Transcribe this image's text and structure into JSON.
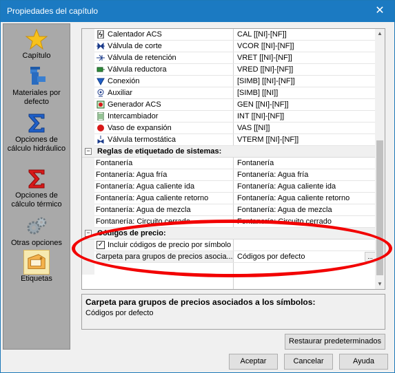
{
  "window": {
    "title": "Propiedades del capítulo",
    "close_glyph": "✕"
  },
  "sidebar": {
    "items": [
      {
        "label": "Capítulo",
        "icon": "star-icon"
      },
      {
        "label": "Materiales por defecto",
        "icon": "pipe-fitting-icon"
      },
      {
        "label": "Opciones de cálculo hidráulico",
        "icon": "blue-sigma-icon"
      },
      {
        "label": "Opciones de cálculo térmico",
        "icon": "red-sigma-icon"
      },
      {
        "label": "Otras opciones",
        "icon": "gears-icon"
      },
      {
        "label": "Etiquetas",
        "icon": "tag-icon",
        "selected": true
      }
    ]
  },
  "grid": {
    "component_rows": [
      {
        "name": "Calentador ACS",
        "value": "CAL [[NI]-[NF]]",
        "icon": "heater-icon"
      },
      {
        "name": "Válvula de corte",
        "value": "VCOR [[NI]-[NF]]",
        "icon": "valve-icon"
      },
      {
        "name": "Válvula de retención",
        "value": "VRET [[NI]-[NF]]",
        "icon": "check-valve-icon"
      },
      {
        "name": "Válvula reductora",
        "value": "VRED [[NI]-[NF]]",
        "icon": "reducing-valve-icon"
      },
      {
        "name": "Conexión",
        "value": "[SIMB] [[NI]-[NF]]",
        "icon": "connection-icon"
      },
      {
        "name": "Auxiliar",
        "value": "[SIMB] [[NI]]",
        "icon": "auxiliary-icon"
      },
      {
        "name": "Generador ACS",
        "value": "GEN [[NI]-[NF]]",
        "icon": "generator-icon"
      },
      {
        "name": "Intercambiador",
        "value": "INT [[NI]-[NF]]",
        "icon": "exchanger-icon"
      },
      {
        "name": "Vaso de expansión",
        "value": "VAS [[NI]]",
        "icon": "expansion-vessel-icon"
      },
      {
        "name": "Válvula termostática",
        "value": "VTERM [[NI]-[NF]]",
        "icon": "thermostatic-valve-icon"
      }
    ],
    "category_systems": {
      "label": "Reglas de etiquetado de sistemas:",
      "toggle": "−"
    },
    "system_rows": [
      {
        "name": "Fontanería",
        "value": "Fontanería"
      },
      {
        "name": "Fontanería: Agua fría",
        "value": "Fontanería: Agua fría"
      },
      {
        "name": "Fontanería: Agua caliente ida",
        "value": "Fontanería: Agua caliente ida"
      },
      {
        "name": "Fontanería: Agua caliente retorno",
        "value": "Fontanería: Agua caliente retorno"
      },
      {
        "name": "Fontanería: Agua de mezcla",
        "value": "Fontanería: Agua de mezcla"
      },
      {
        "name": "Fontanería: Circuito cerrado",
        "value": "Fontanería: Circuito cerrado"
      }
    ],
    "category_prices": {
      "label": "Códigos de precio:",
      "toggle": "−"
    },
    "price_rows": [
      {
        "name": "Incluir códigos de precio por símbolo",
        "value": "",
        "checked": true,
        "check_glyph": "✓"
      },
      {
        "name": "Carpeta para grupos de precios asocia...",
        "value": "Códigos por defecto",
        "ellipsis": "..."
      }
    ]
  },
  "description": {
    "title": "Carpeta para grupos de precios asociados a los símbolos:",
    "text": "Códigos por defecto"
  },
  "buttons": {
    "restore": "Restaurar predeterminados",
    "accept": "Aceptar",
    "cancel": "Cancelar",
    "help": "Ayuda"
  },
  "colors": {
    "title_bar": "#1b7ac2",
    "annotation": "#f20000",
    "sidebar": "#a9a9a9"
  }
}
